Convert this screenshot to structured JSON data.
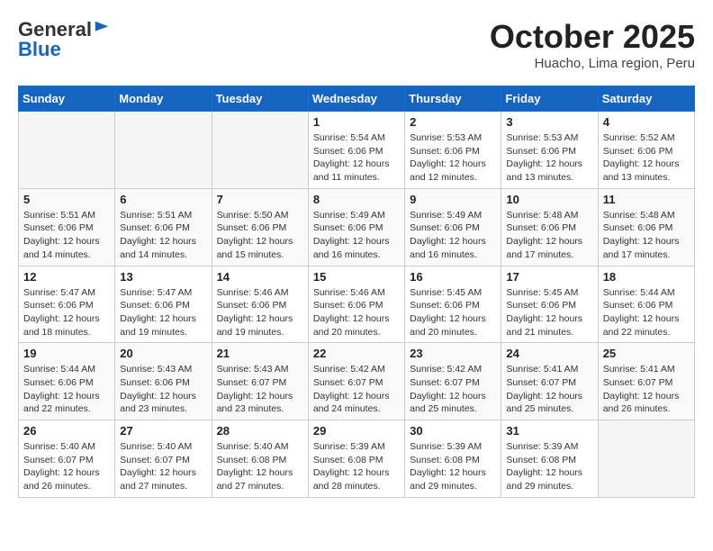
{
  "header": {
    "logo_line1": "General",
    "logo_line2": "Blue",
    "month_title": "October 2025",
    "subtitle": "Huacho, Lima region, Peru"
  },
  "weekdays": [
    "Sunday",
    "Monday",
    "Tuesday",
    "Wednesday",
    "Thursday",
    "Friday",
    "Saturday"
  ],
  "weeks": [
    [
      {
        "day": "",
        "info": ""
      },
      {
        "day": "",
        "info": ""
      },
      {
        "day": "",
        "info": ""
      },
      {
        "day": "1",
        "info": "Sunrise: 5:54 AM\nSunset: 6:06 PM\nDaylight: 12 hours\nand 11 minutes."
      },
      {
        "day": "2",
        "info": "Sunrise: 5:53 AM\nSunset: 6:06 PM\nDaylight: 12 hours\nand 12 minutes."
      },
      {
        "day": "3",
        "info": "Sunrise: 5:53 AM\nSunset: 6:06 PM\nDaylight: 12 hours\nand 13 minutes."
      },
      {
        "day": "4",
        "info": "Sunrise: 5:52 AM\nSunset: 6:06 PM\nDaylight: 12 hours\nand 13 minutes."
      }
    ],
    [
      {
        "day": "5",
        "info": "Sunrise: 5:51 AM\nSunset: 6:06 PM\nDaylight: 12 hours\nand 14 minutes."
      },
      {
        "day": "6",
        "info": "Sunrise: 5:51 AM\nSunset: 6:06 PM\nDaylight: 12 hours\nand 14 minutes."
      },
      {
        "day": "7",
        "info": "Sunrise: 5:50 AM\nSunset: 6:06 PM\nDaylight: 12 hours\nand 15 minutes."
      },
      {
        "day": "8",
        "info": "Sunrise: 5:49 AM\nSunset: 6:06 PM\nDaylight: 12 hours\nand 16 minutes."
      },
      {
        "day": "9",
        "info": "Sunrise: 5:49 AM\nSunset: 6:06 PM\nDaylight: 12 hours\nand 16 minutes."
      },
      {
        "day": "10",
        "info": "Sunrise: 5:48 AM\nSunset: 6:06 PM\nDaylight: 12 hours\nand 17 minutes."
      },
      {
        "day": "11",
        "info": "Sunrise: 5:48 AM\nSunset: 6:06 PM\nDaylight: 12 hours\nand 17 minutes."
      }
    ],
    [
      {
        "day": "12",
        "info": "Sunrise: 5:47 AM\nSunset: 6:06 PM\nDaylight: 12 hours\nand 18 minutes."
      },
      {
        "day": "13",
        "info": "Sunrise: 5:47 AM\nSunset: 6:06 PM\nDaylight: 12 hours\nand 19 minutes."
      },
      {
        "day": "14",
        "info": "Sunrise: 5:46 AM\nSunset: 6:06 PM\nDaylight: 12 hours\nand 19 minutes."
      },
      {
        "day": "15",
        "info": "Sunrise: 5:46 AM\nSunset: 6:06 PM\nDaylight: 12 hours\nand 20 minutes."
      },
      {
        "day": "16",
        "info": "Sunrise: 5:45 AM\nSunset: 6:06 PM\nDaylight: 12 hours\nand 20 minutes."
      },
      {
        "day": "17",
        "info": "Sunrise: 5:45 AM\nSunset: 6:06 PM\nDaylight: 12 hours\nand 21 minutes."
      },
      {
        "day": "18",
        "info": "Sunrise: 5:44 AM\nSunset: 6:06 PM\nDaylight: 12 hours\nand 22 minutes."
      }
    ],
    [
      {
        "day": "19",
        "info": "Sunrise: 5:44 AM\nSunset: 6:06 PM\nDaylight: 12 hours\nand 22 minutes."
      },
      {
        "day": "20",
        "info": "Sunrise: 5:43 AM\nSunset: 6:06 PM\nDaylight: 12 hours\nand 23 minutes."
      },
      {
        "day": "21",
        "info": "Sunrise: 5:43 AM\nSunset: 6:07 PM\nDaylight: 12 hours\nand 23 minutes."
      },
      {
        "day": "22",
        "info": "Sunrise: 5:42 AM\nSunset: 6:07 PM\nDaylight: 12 hours\nand 24 minutes."
      },
      {
        "day": "23",
        "info": "Sunrise: 5:42 AM\nSunset: 6:07 PM\nDaylight: 12 hours\nand 25 minutes."
      },
      {
        "day": "24",
        "info": "Sunrise: 5:41 AM\nSunset: 6:07 PM\nDaylight: 12 hours\nand 25 minutes."
      },
      {
        "day": "25",
        "info": "Sunrise: 5:41 AM\nSunset: 6:07 PM\nDaylight: 12 hours\nand 26 minutes."
      }
    ],
    [
      {
        "day": "26",
        "info": "Sunrise: 5:40 AM\nSunset: 6:07 PM\nDaylight: 12 hours\nand 26 minutes."
      },
      {
        "day": "27",
        "info": "Sunrise: 5:40 AM\nSunset: 6:07 PM\nDaylight: 12 hours\nand 27 minutes."
      },
      {
        "day": "28",
        "info": "Sunrise: 5:40 AM\nSunset: 6:08 PM\nDaylight: 12 hours\nand 27 minutes."
      },
      {
        "day": "29",
        "info": "Sunrise: 5:39 AM\nSunset: 6:08 PM\nDaylight: 12 hours\nand 28 minutes."
      },
      {
        "day": "30",
        "info": "Sunrise: 5:39 AM\nSunset: 6:08 PM\nDaylight: 12 hours\nand 29 minutes."
      },
      {
        "day": "31",
        "info": "Sunrise: 5:39 AM\nSunset: 6:08 PM\nDaylight: 12 hours\nand 29 minutes."
      },
      {
        "day": "",
        "info": ""
      }
    ]
  ]
}
